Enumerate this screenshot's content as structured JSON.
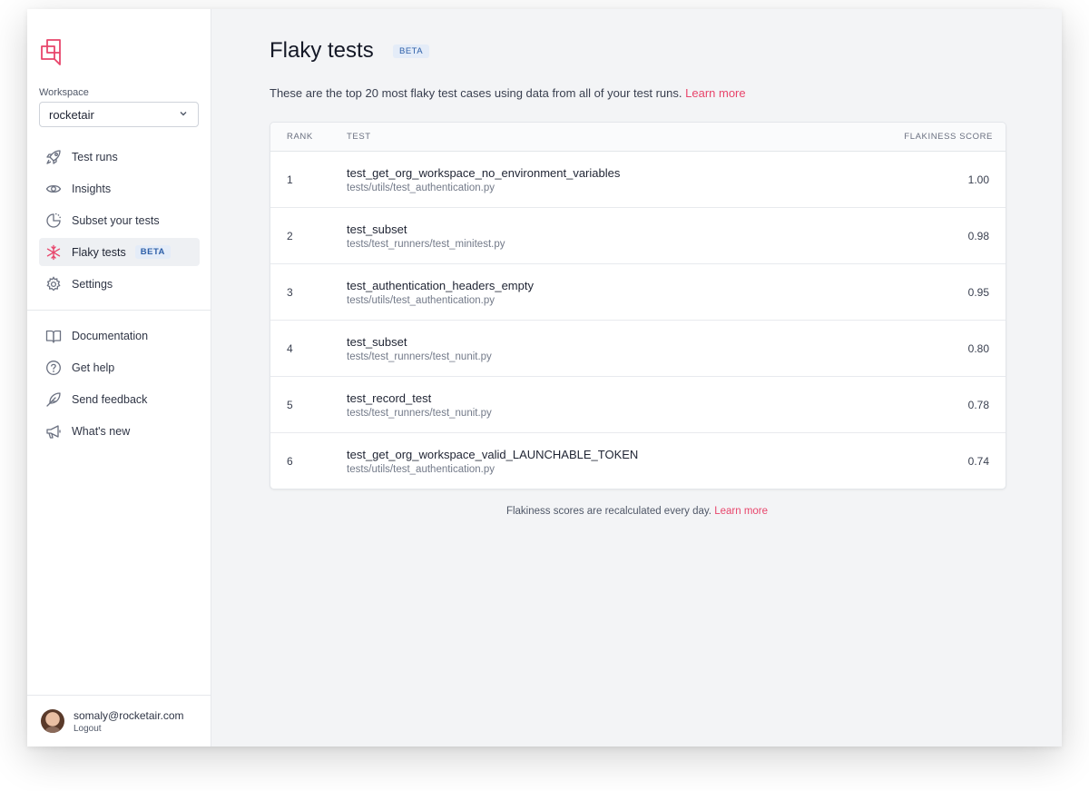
{
  "sidebar": {
    "workspace_label": "Workspace",
    "workspace_value": "rocketair",
    "primary_items": [
      {
        "label": "Test runs",
        "icon": "rocket-icon"
      },
      {
        "label": "Insights",
        "icon": "eye-icon"
      },
      {
        "label": "Subset your tests",
        "icon": "pie-chart-icon"
      },
      {
        "label": "Flaky tests",
        "icon": "snowflake-icon",
        "badge": "BETA",
        "active": true
      },
      {
        "label": "Settings",
        "icon": "gear-icon"
      }
    ],
    "secondary_items": [
      {
        "label": "Documentation",
        "icon": "book-icon"
      },
      {
        "label": "Get help",
        "icon": "help-circle-icon"
      },
      {
        "label": "Send feedback",
        "icon": "feather-icon"
      },
      {
        "label": "What's new",
        "icon": "megaphone-icon"
      }
    ],
    "user": {
      "email": "somaly@rocketair.com",
      "logout": "Logout"
    }
  },
  "main": {
    "title": "Flaky tests",
    "title_badge": "BETA",
    "intro": "These are the top 20 most flaky test cases using data from all of your test runs.",
    "intro_link": "Learn more",
    "table": {
      "headers": {
        "rank": "RANK",
        "test": "TEST",
        "score": "FLAKINESS SCORE"
      },
      "rows": [
        {
          "rank": "1",
          "name": "test_get_org_workspace_no_environment_variables",
          "path": "tests/utils/test_authentication.py",
          "score": "1.00"
        },
        {
          "rank": "2",
          "name": "test_subset",
          "path": "tests/test_runners/test_minitest.py",
          "score": "0.98"
        },
        {
          "rank": "3",
          "name": "test_authentication_headers_empty",
          "path": "tests/utils/test_authentication.py",
          "score": "0.95"
        },
        {
          "rank": "4",
          "name": "test_subset",
          "path": "tests/test_runners/test_nunit.py",
          "score": "0.80"
        },
        {
          "rank": "5",
          "name": "test_record_test",
          "path": "tests/test_runners/test_nunit.py",
          "score": "0.78"
        },
        {
          "rank": "6",
          "name": "test_get_org_workspace_valid_LAUNCHABLE_TOKEN",
          "path": "tests/utils/test_authentication.py",
          "score": "0.74"
        }
      ]
    },
    "footnote": "Flakiness scores are recalculated every day.",
    "footnote_link": "Learn more"
  },
  "colors": {
    "accent": "#e8456b",
    "badge_bg": "#e4ecf8",
    "badge_text": "#2d5fa8",
    "main_bg": "#f3f4f6"
  }
}
